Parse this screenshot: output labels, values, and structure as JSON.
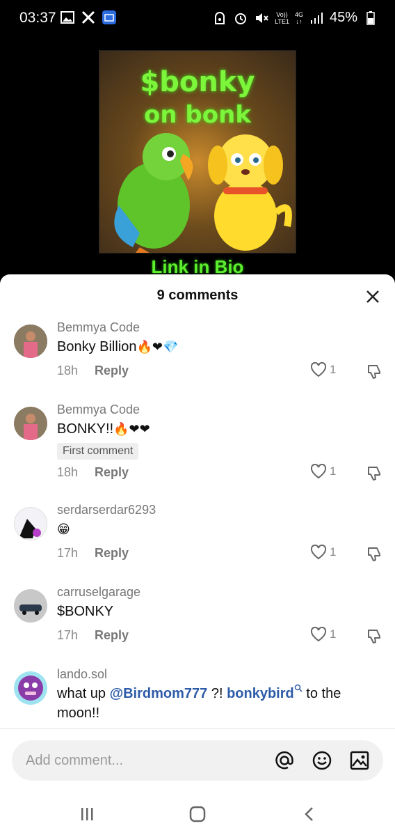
{
  "status_bar": {
    "time": "03:37",
    "volte_top": "Vo))",
    "volte_bottom": "LTE1",
    "network_type": "4G",
    "battery": "45%"
  },
  "video": {
    "poster_line1": "$bonky",
    "poster_line2": "on bonk",
    "link_text": "Link in Bio"
  },
  "comments_sheet": {
    "count_label": "9 comments",
    "comments": [
      {
        "user": "Bemmya Code",
        "text": "Bonky Billion",
        "emojis": "🔥❤💎",
        "time": "18h",
        "reply": "Reply",
        "likes": "1"
      },
      {
        "user": "Bemmya Code",
        "text": "BONKY!!",
        "emojis": "🔥❤❤",
        "badge": "First comment",
        "time": "18h",
        "reply": "Reply",
        "likes": "1"
      },
      {
        "user": "serdarserdar6293",
        "text": "",
        "emojis": "😁",
        "time": "17h",
        "reply": "Reply",
        "likes": "1"
      },
      {
        "user": "carruselgarage",
        "text": "$BONKY",
        "time": "17h",
        "reply": "Reply",
        "likes": "1"
      },
      {
        "user": "lando.sol",
        "text_prefix": "what up ",
        "mention": "@Birdmom777",
        "text_mid": " ?! ",
        "link": "bonkybird",
        "text_suffix": " to the moon!!"
      }
    ]
  },
  "input": {
    "placeholder": "Add comment..."
  }
}
